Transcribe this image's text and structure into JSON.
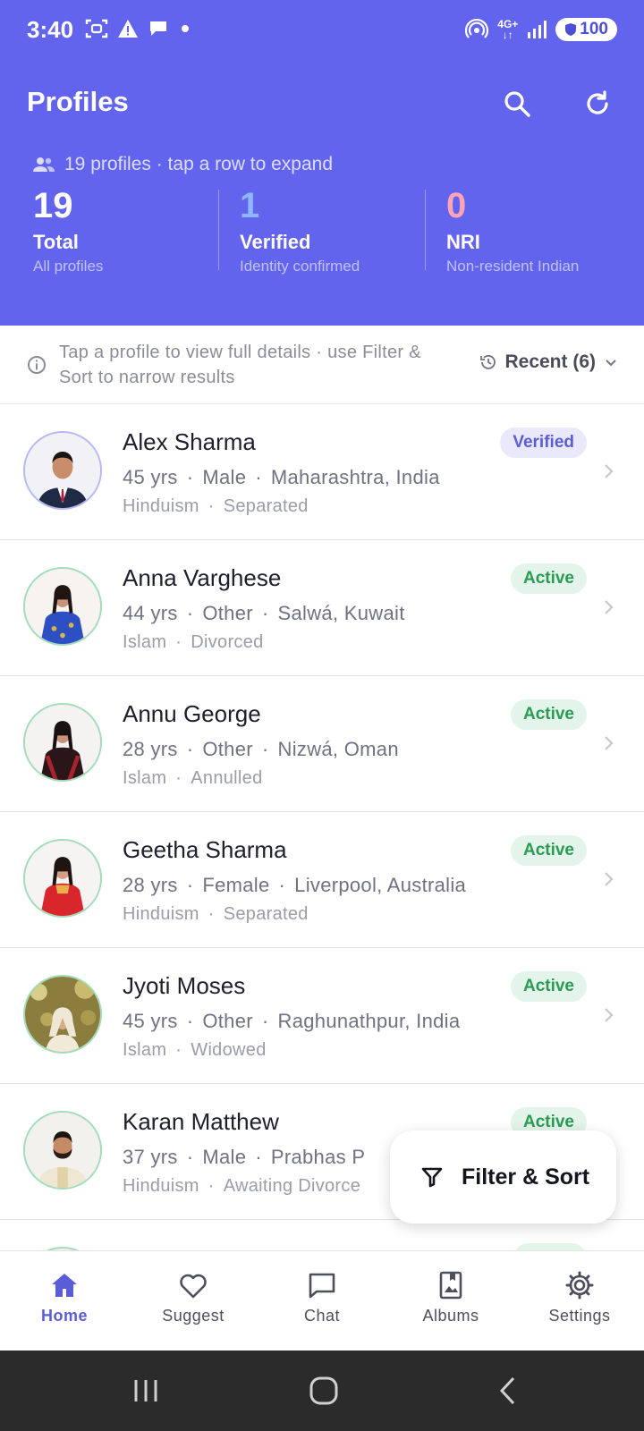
{
  "status": {
    "time": "3:40",
    "network": "4G+",
    "battery": "100"
  },
  "header": {
    "title": "Profiles",
    "count_line": "19 profiles · tap a row to expand",
    "stats": [
      {
        "value": "19",
        "label": "Total",
        "sub": "All profiles",
        "color": "#ffffff"
      },
      {
        "value": "1",
        "label": "Verified",
        "sub": "Identity confirmed",
        "color": "#8fb6ff"
      },
      {
        "value": "0",
        "label": "NRI",
        "sub": "Non-resident Indian",
        "color": "#ffa4b4"
      }
    ]
  },
  "info": {
    "text": "Tap a profile to view full details · use Filter & Sort to narrow results",
    "recent_label": "Recent (6)"
  },
  "profiles": [
    {
      "name": "Alex Sharma",
      "age": "45 yrs",
      "gender": "Male",
      "location": "Maharashtra, India",
      "religion": "Hinduism",
      "status": "Separated",
      "badge": "Verified"
    },
    {
      "name": "Anna Varghese",
      "age": "44 yrs",
      "gender": "Other",
      "location": "Salwá, Kuwait",
      "religion": "Islam",
      "status": "Divorced",
      "badge": "Active"
    },
    {
      "name": "Annu George",
      "age": "28 yrs",
      "gender": "Other",
      "location": "Nizwá, Oman",
      "religion": "Islam",
      "status": "Annulled",
      "badge": "Active"
    },
    {
      "name": "Geetha Sharma",
      "age": "28 yrs",
      "gender": "Female",
      "location": "Liverpool, Australia",
      "religion": "Hinduism",
      "status": "Separated",
      "badge": "Active"
    },
    {
      "name": "Jyoti Moses",
      "age": "45 yrs",
      "gender": "Other",
      "location": "Raghunathpur, India",
      "religion": "Islam",
      "status": "Widowed",
      "badge": "Active"
    },
    {
      "name": "Karan Matthew",
      "age": "37 yrs",
      "gender": "Male",
      "location": "Prabhas P",
      "religion": "Hinduism",
      "status": "Awaiting Divorce",
      "badge": "Active"
    }
  ],
  "fab": {
    "label": "Filter & Sort"
  },
  "nav": [
    {
      "label": "Home",
      "icon": "home-icon"
    },
    {
      "label": "Suggest",
      "icon": "heart-icon"
    },
    {
      "label": "Chat",
      "icon": "chat-icon"
    },
    {
      "label": "Albums",
      "icon": "album-icon"
    },
    {
      "label": "Settings",
      "icon": "gear-icon"
    }
  ],
  "colors": {
    "header_bg": "#6264ee",
    "accent": "#5b5dd6",
    "active_badge_bg": "#e3f5ea",
    "active_badge_text": "#2c9a55"
  }
}
